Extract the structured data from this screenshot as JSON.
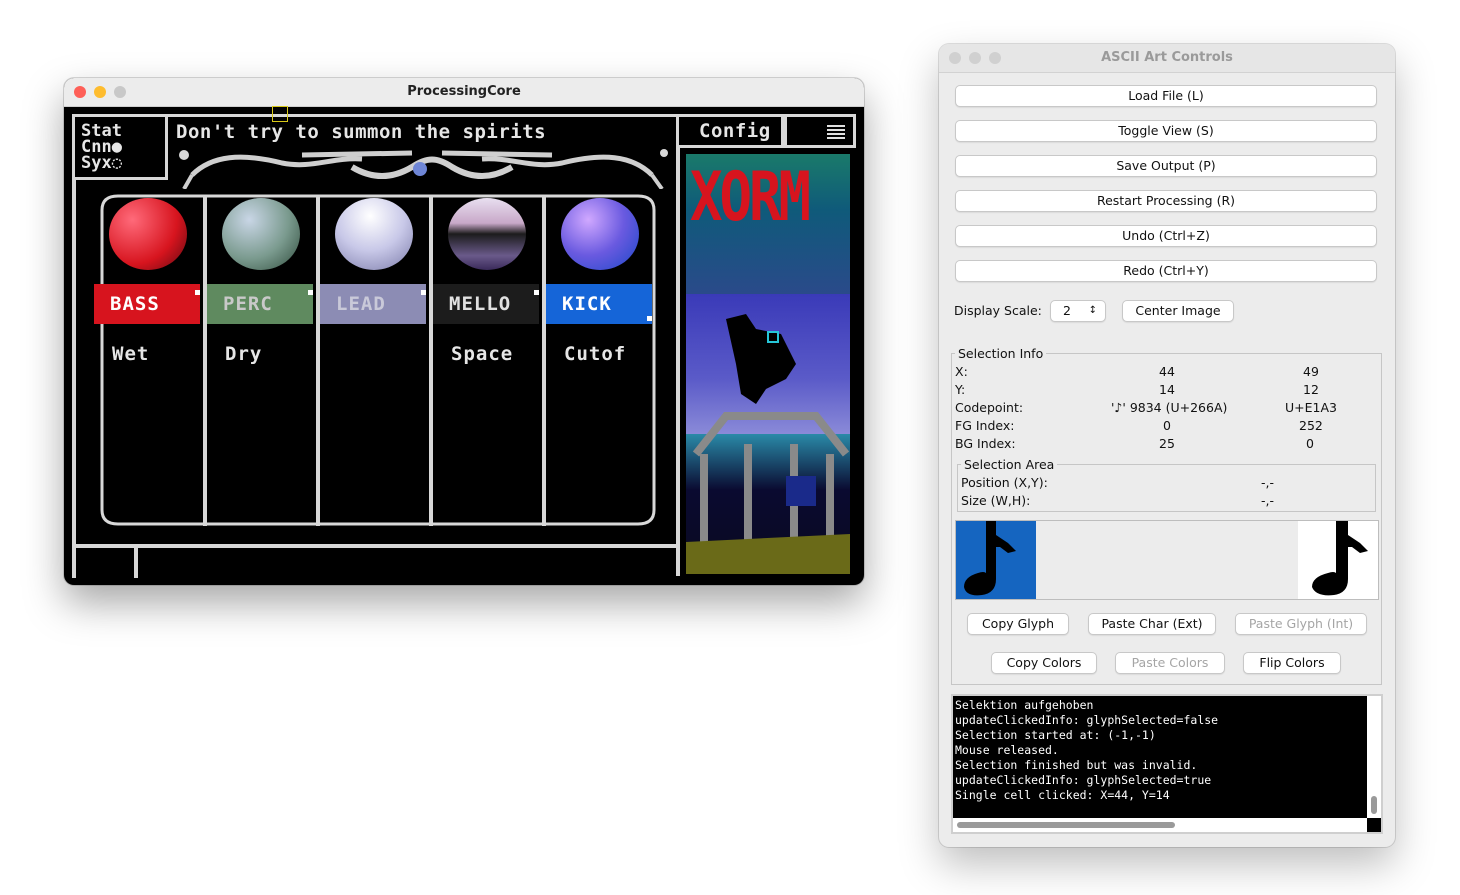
{
  "processing": {
    "title": "ProcessingCore",
    "status_lines": [
      "Stat",
      "Cnn●",
      "Syx◌"
    ],
    "marquee": "Don't try to summon the spirits",
    "config_label": "Config",
    "menu_icon": "hamburger-icon",
    "preview_title": "XORM",
    "channels": [
      {
        "label": "BASS",
        "param": "Wet",
        "label_bg": "#d7141e",
        "label_fg": "#ffffff",
        "orb": "#e8283a"
      },
      {
        "label": "PERC",
        "param": "Dry",
        "label_bg": "#5f8a5f",
        "label_fg": "#c9c9c9",
        "orb": "#7a9a8e"
      },
      {
        "label": "LEAD",
        "param": "",
        "label_bg": "#8c8cb4",
        "label_fg": "#c9c9d9",
        "orb": "#b8b8d8"
      },
      {
        "label": "MELLO",
        "param": "Space",
        "label_bg": "#1c1c1c",
        "label_fg": "#e0e0e0",
        "orb": "#7a6a8a"
      },
      {
        "label": "KICK",
        "param": "Cutof",
        "label_bg": "#1565d8",
        "label_fg": "#ffffff",
        "orb": "#6a5ae0"
      }
    ]
  },
  "controls": {
    "title": "ASCII Art Controls",
    "buttons": {
      "load": "Load File (L)",
      "toggle": "Toggle View (S)",
      "save": "Save Output (P)",
      "restart": "Restart Processing (R)",
      "undo": "Undo (Ctrl+Z)",
      "redo": "Redo (Ctrl+Y)"
    },
    "display_scale_label": "Display Scale:",
    "display_scale_value": "2",
    "center_image": "Center Image",
    "selection_info": {
      "title": "Selection Info",
      "rows": [
        {
          "label": "X:",
          "a": "44",
          "b": "49"
        },
        {
          "label": "Y:",
          "a": "14",
          "b": "12"
        },
        {
          "label": "Codepoint:",
          "a": "'♪' 9834 (U+266A)",
          "b": "U+E1A3"
        },
        {
          "label": "FG Index:",
          "a": "0",
          "b": "252"
        },
        {
          "label": "BG Index:",
          "a": "25",
          "b": "0"
        }
      ]
    },
    "selection_area": {
      "title": "Selection Area",
      "position_label": "Position (X,Y):",
      "position_value": "-,-",
      "size_label": "Size (W,H):",
      "size_value": "-,-"
    },
    "glyph_buttons": {
      "copy_glyph": "Copy Glyph",
      "paste_char": "Paste Char (Ext)",
      "paste_glyph": "Paste Glyph (Int)",
      "copy_colors": "Copy Colors",
      "paste_colors": "Paste Colors",
      "flip_colors": "Flip Colors"
    },
    "log": [
      "Selektion aufgehoben",
      "updateClickedInfo: glyphSelected=false",
      "Selection started at: (-1,-1)",
      "Mouse released.",
      "Selection finished but was invalid.",
      "updateClickedInfo: glyphSelected=true",
      "Single cell clicked: X=44, Y=14"
    ]
  }
}
